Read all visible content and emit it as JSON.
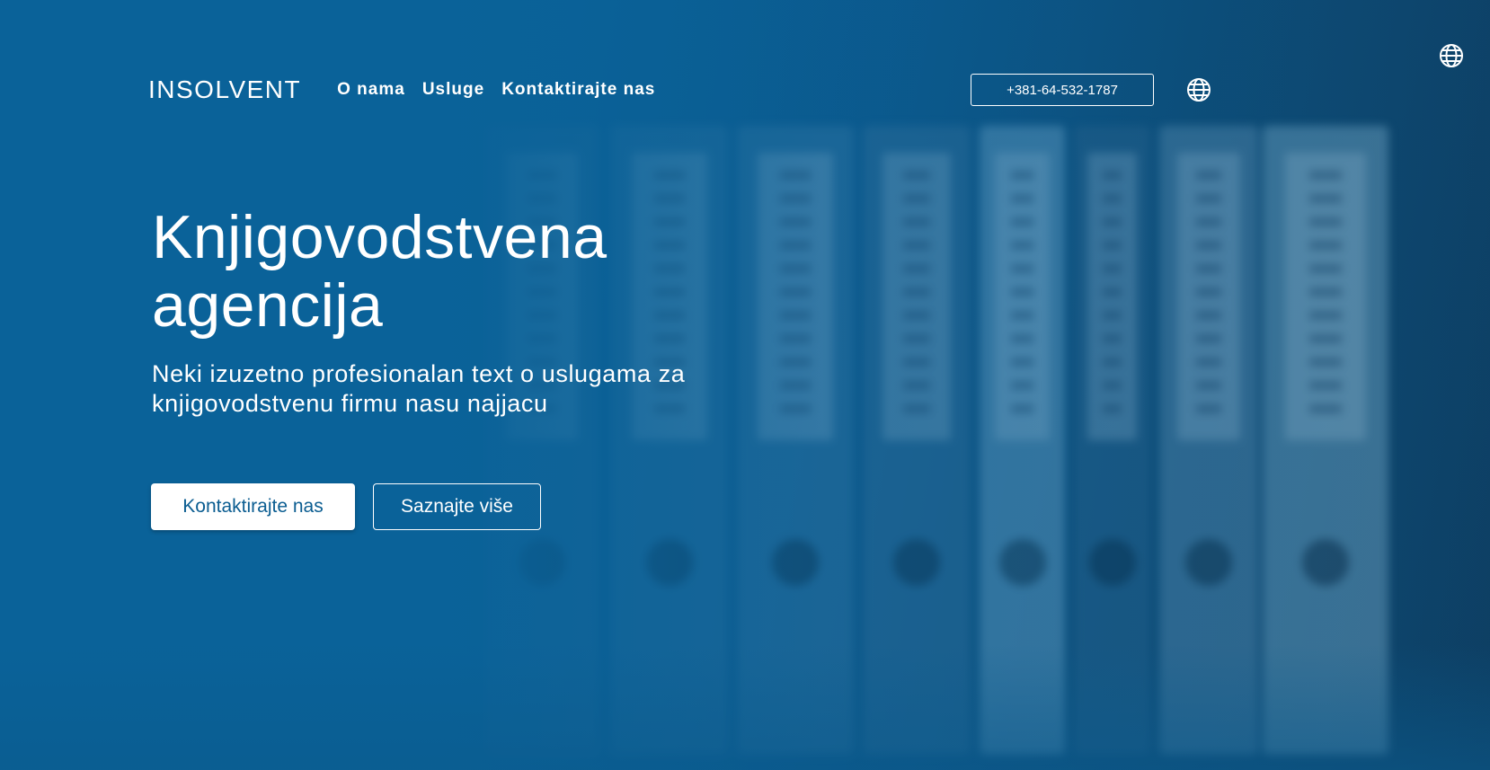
{
  "brand": {
    "logo_text": "INSOLVENT"
  },
  "nav": {
    "items": [
      {
        "label": "O nama"
      },
      {
        "label": "Usluge"
      },
      {
        "label": "Kontaktirajte nas"
      }
    ],
    "phone": "+381-64-532-1787",
    "language_icon": "globe-icon"
  },
  "hero": {
    "title_line1": "Knjigovodstvena",
    "title_line2": "agencija",
    "subtitle": "Neki izuzetno profesionalan text o uslugama za knjigovodstvenu firmu nasu najjacu",
    "primary_button": "Kontaktirajte nas",
    "secondary_button": "Saznajte više"
  },
  "colors": {
    "background": "#0a6299",
    "text": "#ffffff",
    "primary_button_text": "#0b5d91"
  }
}
